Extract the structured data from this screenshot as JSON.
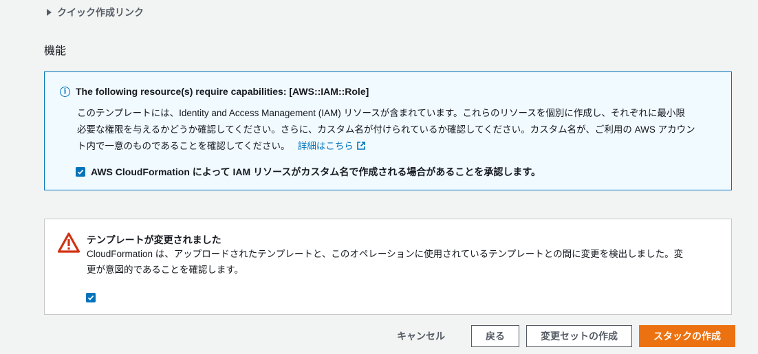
{
  "quick_links": {
    "label": "クイック作成リンク"
  },
  "capabilities": {
    "section_title": "機能",
    "info": {
      "title": "The following resource(s) require capabilities: [AWS::IAM::Role]",
      "body_lines": [
        "このテンプレートには、Identity and Access Management (IAM) リソースが含まれています。これらのリソースを個別に作成し、それぞれに最小限",
        "必要な権限を与えるかどうか確認してください。さらに、カスタム名が付けられているか確認してください。カスタム名が、ご利用の AWS アカウン",
        "ト内で一意のものであることを確認してください。"
      ],
      "link_label": "詳細はこちら",
      "ack_label": "AWS CloudFormation によって IAM リソースがカスタム名で作成される場合があることを承認します。",
      "ack_checked": true
    }
  },
  "warning": {
    "title": "テンプレートが変更されました",
    "body_lines": [
      "CloudFormation は、アップロードされたテンプレートと、このオペレーションに使用されているテンプレートとの間に変更を検出しました。変",
      "更が意図的であることを確認します。"
    ],
    "ack_checked": true
  },
  "actions": {
    "cancel": "キャンセル",
    "back": "戻る",
    "create_change_set": "変更セットの作成",
    "create_stack": "スタックの作成"
  },
  "colors": {
    "accent": "#0073bb",
    "primary_button": "#ec7211",
    "warning": "#d13212",
    "info_bg": "#f1faff"
  }
}
